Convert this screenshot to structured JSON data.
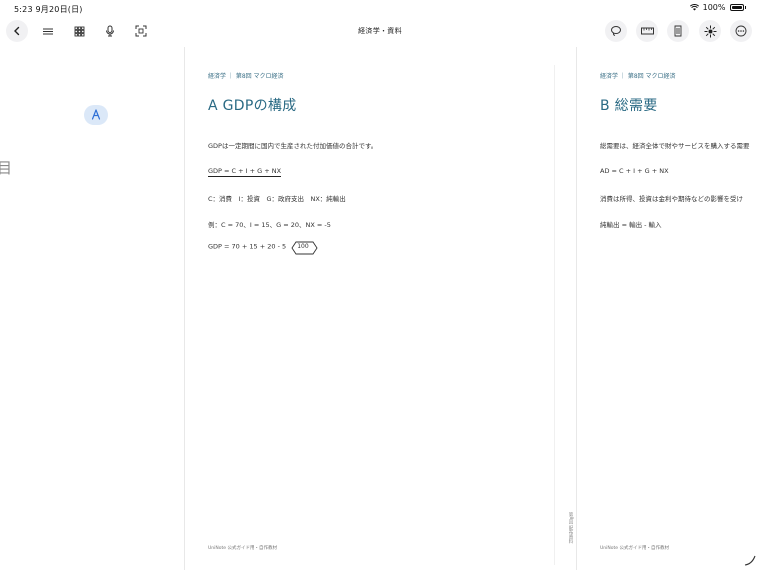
{
  "status_bar": {
    "time": "5:23",
    "date": "9月20日(日)",
    "battery": "100%"
  },
  "toolbar": {
    "title": "経済学・資料",
    "left_icons": [
      "back-icon",
      "menu-icon",
      "grid-icon",
      "mic-icon",
      "scan-icon"
    ],
    "right_icons": [
      "lasso-icon",
      "ruler-icon",
      "page-icon",
      "laser-icon",
      "more-icon"
    ]
  },
  "left_pane": {
    "glyph": "目"
  },
  "page1": {
    "breadcrumb": "経済学 ｜ 第8回 マクロ経済",
    "heading": "A  GDPの構成",
    "lines": [
      "GDPは一定期間に国内で生産された付加価値の合計です。",
      "GDP = C + I + G + NX",
      "C：消費　I：投資　G：政府支出　NX：純輸出",
      "例：C = 70、I = 15、G = 20、NX = -5",
      "GDP = 70 + 15 + 20 - 5"
    ],
    "answer": "100",
    "footer": "UniNote 公式ガイド用・自作教材",
    "side_note": "第8回 配布資料"
  },
  "page2": {
    "breadcrumb": "経済学 ｜ 第8回 マクロ経済",
    "heading": "B  総需要",
    "lines": [
      "総需要は、経済全体で財やサービスを購入する需要",
      "AD = C + I + G + NX",
      "消費は所得、投資は金利や期待などの影響を受け",
      "純輸出 = 輸出 - 輸入"
    ],
    "footer": "UniNote 公式ガイド用・自作教材"
  },
  "colors": {
    "accent": "#2a6a84",
    "pen_bg": "#dbe8f8",
    "pen_icon": "#2f6fd6"
  }
}
